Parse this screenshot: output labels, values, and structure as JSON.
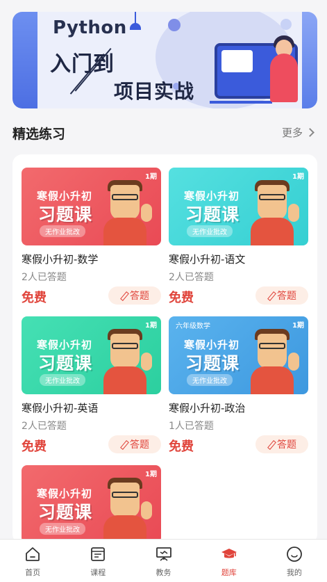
{
  "banner": {
    "line_python": "Python",
    "line_1": "入门到",
    "line_2": "项目实战"
  },
  "section": {
    "title": "精选练习",
    "more": "更多"
  },
  "colors": {
    "accent": "#e0443b",
    "red_card": "#ef5a5f",
    "cyan_card": "#3fd6d6",
    "green_card": "#33d6a8",
    "blue_card": "#4aa6e6"
  },
  "items": [
    {
      "name": "寒假小升初-数学",
      "count": "2人已答题",
      "price": "免费",
      "button": "答题",
      "tag": "1期",
      "grade": "",
      "t1": "寒假小升初",
      "t2": "习题课",
      "pill": "无作业批改"
    },
    {
      "name": "寒假小升初-语文",
      "count": "2人已答题",
      "price": "免费",
      "button": "答题",
      "tag": "1期",
      "grade": "",
      "t1": "寒假小升初",
      "t2": "习题课",
      "pill": "无作业批改"
    },
    {
      "name": "寒假小升初-英语",
      "count": "2人已答题",
      "price": "免费",
      "button": "答题",
      "tag": "1期",
      "grade": "",
      "t1": "寒假小升初",
      "t2": "习题课",
      "pill": "无作业批改"
    },
    {
      "name": "寒假小升初-政治",
      "count": "1人已答题",
      "price": "免费",
      "button": "答题",
      "tag": "1期",
      "grade": "六年级数学",
      "t1": "寒假小升初",
      "t2": "习题课",
      "pill": "无作业批改"
    },
    {
      "name": "",
      "count": "",
      "price": "",
      "button": "",
      "tag": "1期",
      "grade": "",
      "t1": "寒假小升初",
      "t2": "习题课",
      "pill": "无作业批改"
    }
  ],
  "tabs": [
    {
      "label": "首页",
      "icon": "home-icon"
    },
    {
      "label": "课程",
      "icon": "course-icon"
    },
    {
      "label": "教务",
      "icon": "board-icon"
    },
    {
      "label": "题库",
      "icon": "graduation-cap-icon",
      "active": true
    },
    {
      "label": "我的",
      "icon": "smiley-icon"
    }
  ]
}
